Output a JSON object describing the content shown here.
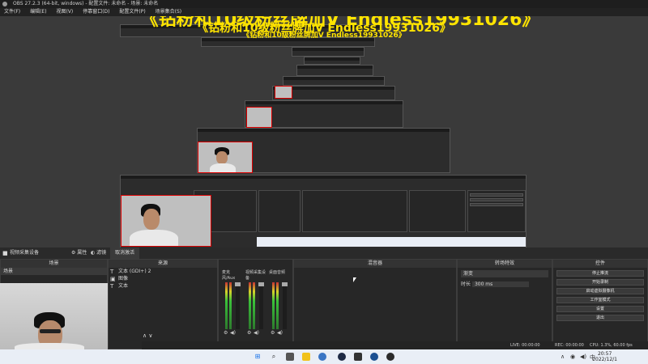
{
  "window": {
    "title": "OBS 27.2.3 (64-bit, windows) - 配置文件: 未命名 - 场景: 未命名"
  },
  "menu": {
    "items": [
      "文件(F)",
      "编辑(E)",
      "视图(V)",
      "停靠窗口(D)",
      "配置文件(P)",
      "场景集合(S)",
      "工具(T)",
      "帮助(H)"
    ]
  },
  "preview": {
    "banner_text": "《钻粉和10级粉丝牌加V Endless19931026》"
  },
  "toolbar": {
    "source_name": "视频采集设备",
    "properties_label": "属性",
    "filters_label": "滤镜",
    "deactivate_label": "取消激活"
  },
  "docks": {
    "scenes": {
      "title": "场景",
      "items": [
        "场景"
      ]
    },
    "sources": {
      "title": "来源",
      "items": [
        "文本 (GDI+) 2",
        "图像",
        "文本"
      ]
    },
    "mixer": {
      "title": "混音器",
      "channels": [
        {
          "name": "麦克风/Aux",
          "db": "0.0 dB"
        },
        {
          "name": "视频采集设备",
          "db": "0.0 dB"
        },
        {
          "name": "桌面音频",
          "db": "0.0 dB"
        }
      ]
    },
    "transitions": {
      "title": "转场特效",
      "type": "渐变",
      "duration_label": "时长",
      "duration_value": "300 ms"
    },
    "controls": {
      "title": "控件",
      "buttons": [
        "停止推流",
        "开始录制",
        "启动虚拟摄像机",
        "工作室模式",
        "设置",
        "退出"
      ]
    }
  },
  "status": {
    "live": "LIVE: 00:00:00",
    "rec": "REC: 00:00:00",
    "cpu": "CPU: 1.3%, 60.00 fps",
    "dropped": "丢帧 0 (0.0%)"
  },
  "taskbar": {
    "time": "20:57",
    "date": "2022/12/1"
  },
  "colors": {
    "banner": "#ffe400",
    "accent": "#3a75c4",
    "selection_border": "#dd0000"
  }
}
